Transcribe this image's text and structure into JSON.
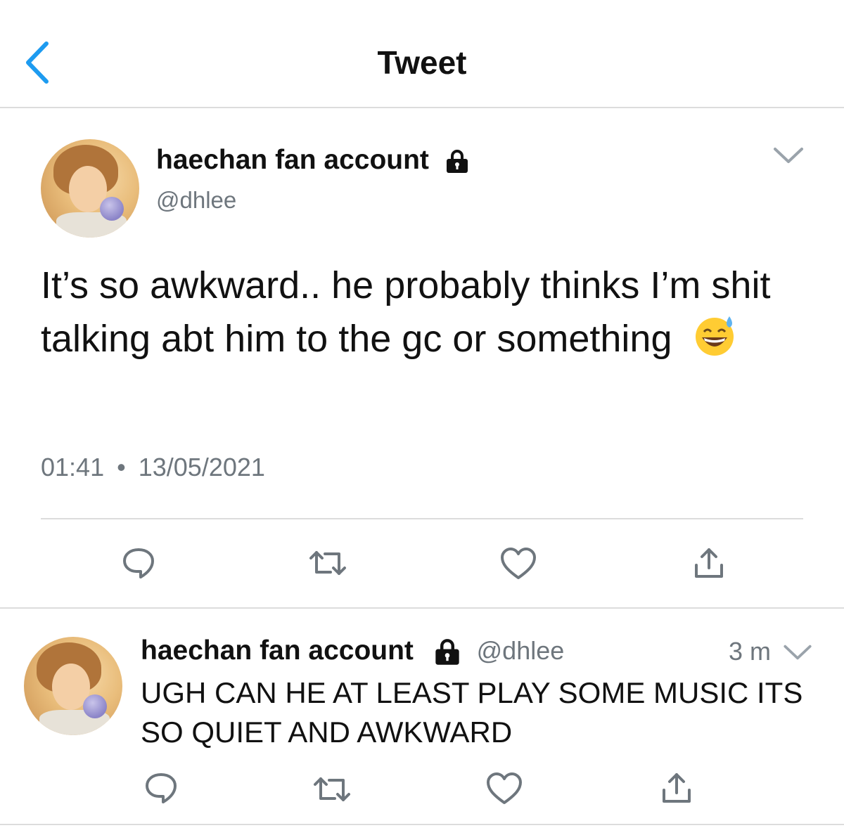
{
  "header": {
    "title": "Tweet"
  },
  "main_tweet": {
    "display_name": "haechan fan account",
    "handle": "@dhlee",
    "text": "It’s so awkward.. he probably thinks I’m shit talking abt him to the gc or something",
    "time": "01:41",
    "separator": "•",
    "date": "13/05/2021",
    "emoji": "grinning-sweat-emoji"
  },
  "reply_tweet": {
    "display_name": "haechan fan account",
    "handle": "@dhlee",
    "relative_time": "3 m",
    "text": "UGH CAN HE AT LEAST PLAY SOME MUSIC ITS SO QUIET AND AWKWARD"
  },
  "icons": [
    "back-chevron-icon",
    "lock-icon",
    "chevron-down-icon",
    "reply-icon",
    "retweet-icon",
    "like-icon",
    "share-icon"
  ],
  "colors": {
    "accent": "#1d9bf0",
    "secondary_text": "#6e767d",
    "divider": "#dcdcdc"
  }
}
